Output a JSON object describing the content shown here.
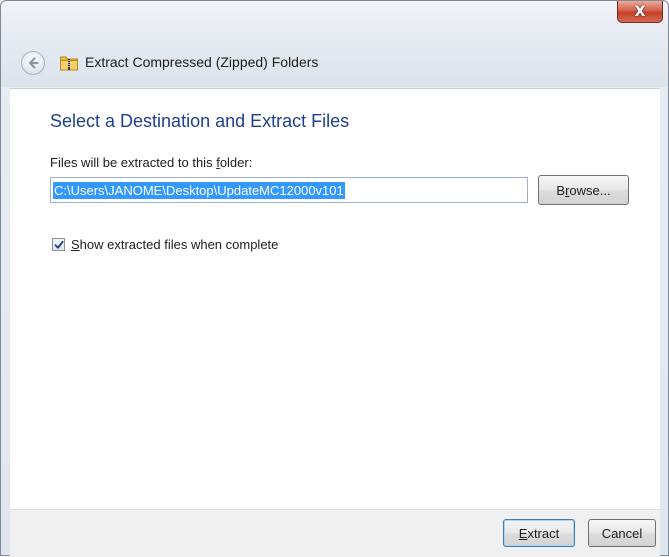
{
  "window": {
    "title": "Extract Compressed (Zipped) Folders",
    "close_label": "X"
  },
  "content": {
    "heading": "Select a Destination and Extract Files",
    "dest_label_pre": "Files will be extracted to this ",
    "dest_label_key": "f",
    "dest_label_post": "older:",
    "path_value": "C:\\Users\\JANOME\\Desktop\\UpdateMC12000v101",
    "browse_pre": "B",
    "browse_key": "r",
    "browse_post": "owse...",
    "show_files_key": "S",
    "show_files_post": "how extracted files when complete",
    "show_files_checked": true
  },
  "footer": {
    "extract_key": "E",
    "extract_post": "xtract",
    "cancel_label": "Cancel"
  },
  "icons": {
    "back": "back-arrow-icon",
    "folder": "zip-folder-icon",
    "close": "close-icon",
    "check": "checkmark-icon"
  },
  "colors": {
    "heading": "#1f3f8f",
    "selection": "#3399ff",
    "close_button": "#c4402a"
  }
}
